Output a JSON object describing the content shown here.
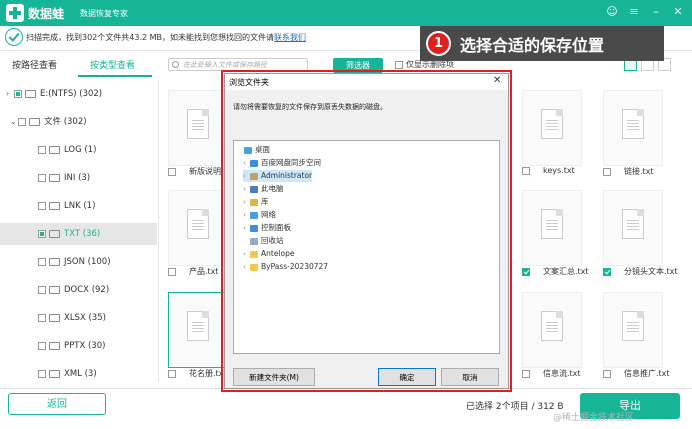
{
  "app": {
    "brand": "数据蛙",
    "subtitle": "数据恢复专家",
    "controls": [
      "☺",
      "≡",
      "–",
      "✕"
    ]
  },
  "infobar": {
    "message": "扫描完成，找到302个文件共43.2 MB，如未能找到您想找回的文件请",
    "link": "联系我们"
  },
  "callout": {
    "number": "1",
    "text": "选择合适的保存位置"
  },
  "tabs": {
    "path": "按路径查看",
    "type": "按类型查看"
  },
  "search": {
    "placeholder": "在此处输入文件或保存路径"
  },
  "toolbar": {
    "filter": "筛选器",
    "deleted_only": "仅显示删除项"
  },
  "tree": [
    {
      "label": "E:(NTFS) (302)",
      "level": 0,
      "chev": "›",
      "state": "part"
    },
    {
      "label": "文件 (302)",
      "level": 1,
      "chev": "⌄",
      "state": "none"
    },
    {
      "label": "LOG (1)",
      "level": 2,
      "state": "none"
    },
    {
      "label": "INI (3)",
      "level": 2,
      "state": "none"
    },
    {
      "label": "LNK (1)",
      "level": 2,
      "state": "none"
    },
    {
      "label": "TXT (36)",
      "level": 2,
      "state": "part",
      "selected": true
    },
    {
      "label": "JSON (100)",
      "level": 2,
      "state": "none"
    },
    {
      "label": "DOCX (92)",
      "level": 2,
      "state": "none"
    },
    {
      "label": "XLSX (35)",
      "level": 2,
      "state": "none"
    },
    {
      "label": "PPTX (30)",
      "level": 2,
      "state": "none"
    },
    {
      "label": "XML (3)",
      "level": 2,
      "state": "none"
    }
  ],
  "files": [
    {
      "name": "新版说明.txt",
      "checked": false
    },
    {
      "name": "keys.txt",
      "checked": false
    },
    {
      "name": "链接.txt",
      "checked": false
    },
    {
      "name": "产品.txt",
      "checked": false
    },
    {
      "name": "文案汇总.txt",
      "checked": true
    },
    {
      "name": "分镜头文本.txt",
      "checked": true
    },
    {
      "name": "花名册.txt",
      "checked": false
    },
    {
      "name": "信息流.txt",
      "checked": false
    },
    {
      "name": "信息推广.txt",
      "checked": false
    }
  ],
  "bottom": {
    "back": "返回",
    "status": "已选择 2个项目 / 312  B",
    "export": "导出",
    "watermark": "@稀土掘金技术社区"
  },
  "dialog": {
    "title": "浏览文件夹",
    "close": "✕",
    "description": "请勿将需要恢复的文件保存到原丢失数据的磁盘。",
    "items": [
      {
        "label": "桌面",
        "arrow": "",
        "color": "#4a9fe0"
      },
      {
        "label": "百度网盘同步空间",
        "arrow": "›",
        "color": "#3a8ee6"
      },
      {
        "label": "Administrator",
        "arrow": "›",
        "color": "#c8a060",
        "selected": true
      },
      {
        "label": "此电脑",
        "arrow": "›",
        "color": "#4a7fb5"
      },
      {
        "label": "库",
        "arrow": "›",
        "color": "#e3b341"
      },
      {
        "label": "网络",
        "arrow": "›",
        "color": "#4a9fe0"
      },
      {
        "label": "控制面板",
        "arrow": "›",
        "color": "#3a8ee6"
      },
      {
        "label": "回收站",
        "arrow": "",
        "color": "#9ab"
      },
      {
        "label": "Antelope",
        "arrow": "›",
        "color": "#f2c94c"
      },
      {
        "label": "ByPass-20230727",
        "arrow": "›",
        "color": "#f2c94c"
      }
    ],
    "new_folder": "新建文件夹(M)",
    "ok": "确定",
    "cancel": "取消"
  }
}
